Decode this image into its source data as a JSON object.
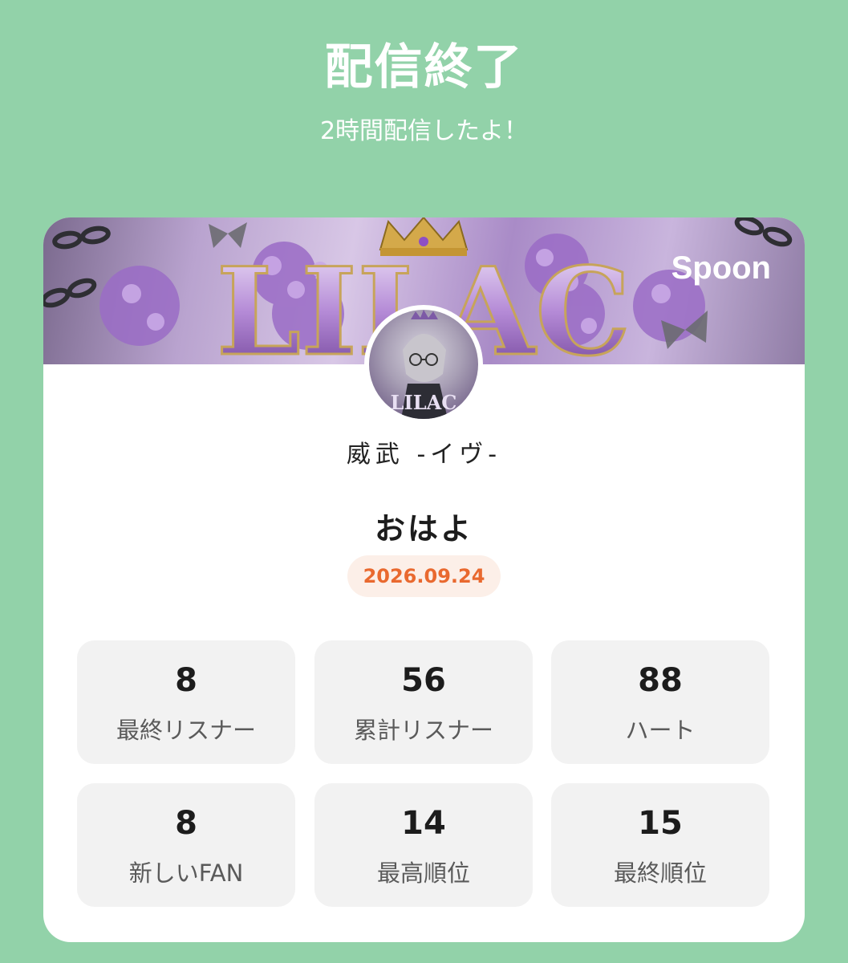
{
  "header": {
    "title": "配信終了",
    "subtitle": "2時間配信したよ！"
  },
  "card": {
    "brand": "Spoon",
    "banner_text": "LILAC",
    "avatar_text": "LILAC",
    "username": "威武 -イヴ-",
    "live_title": "おはよ",
    "date": "2026.09.24",
    "stats": [
      {
        "value": "8",
        "label": "最終リスナー"
      },
      {
        "value": "56",
        "label": "累計リスナー"
      },
      {
        "value": "88",
        "label": "ハート"
      },
      {
        "value": "8",
        "label": "新しいFAN"
      },
      {
        "value": "14",
        "label": "最高順位"
      },
      {
        "value": "15",
        "label": "最終順位"
      }
    ]
  },
  "colors": {
    "background": "#92d2a9",
    "date_text": "#e9692f",
    "date_bg": "#fcefe8",
    "stat_bg": "#f2f2f2"
  }
}
